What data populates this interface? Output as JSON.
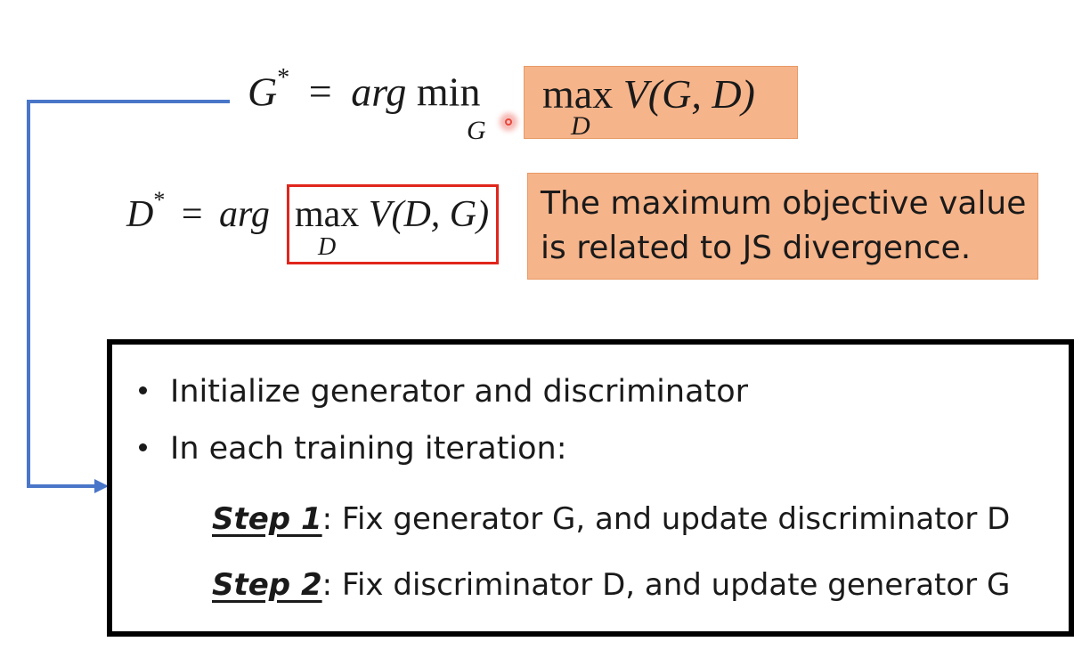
{
  "eq_g": {
    "lhs": "G",
    "star": "*",
    "eq": "=",
    "argword": "arg",
    "minword": "min",
    "min_sub": "G",
    "maxword": "max",
    "max_sub": "D",
    "body": "V(G, D)"
  },
  "eq_d": {
    "lhs": "D",
    "star": "*",
    "eq": "=",
    "argword": "arg",
    "maxword": "max",
    "max_sub": "D",
    "body": "V(D, G)"
  },
  "note": {
    "line1": "The maximum objective value",
    "line2": "is related to JS divergence."
  },
  "algorithm": {
    "bullets": [
      "Initialize generator and discriminator",
      "In each training iteration:"
    ],
    "steps": [
      {
        "label": "Step 1",
        "text": ": Fix generator G, and update discriminator D"
      },
      {
        "label": "Step 2",
        "text": ": Fix discriminator D, and update generator G"
      }
    ]
  },
  "colors": {
    "connector": "#4a76c9",
    "highlight_fill": "#f6b48a",
    "red_box": "#e0261c",
    "pointer": "#e8483c"
  }
}
